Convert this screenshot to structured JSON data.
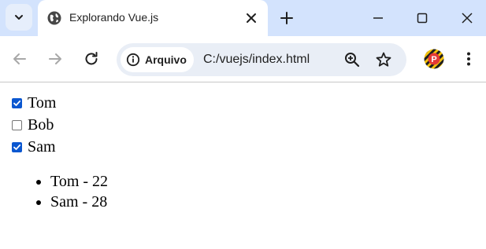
{
  "browser": {
    "tab_title": "Explorando Vue.js",
    "chip_label": "Arquivo",
    "url": "C:/vuejs/index.html",
    "profile_initial": "P"
  },
  "icons": {
    "tab_list": "chevron-down-icon",
    "favicon": "globe-icon",
    "tab_close": "close-icon",
    "new_tab": "plus-icon",
    "minimize": "minimize-icon",
    "maximize": "maximize-icon",
    "window_close": "close-icon",
    "back": "arrow-left-icon",
    "forward": "arrow-right-icon",
    "reload": "reload-icon",
    "site_info": "info-icon",
    "zoom": "zoom-in-icon",
    "bookmark": "star-icon",
    "menu": "more-vert-icon"
  },
  "page": {
    "checkboxes": [
      {
        "label": "Tom",
        "checked": true
      },
      {
        "label": "Bob",
        "checked": false
      },
      {
        "label": "Sam",
        "checked": true
      }
    ],
    "list": [
      "Tom - 22",
      "Sam - 28"
    ]
  },
  "colors": {
    "tabstrip": "#d3e3fd",
    "checkbox_checked": "#0b57d0"
  }
}
